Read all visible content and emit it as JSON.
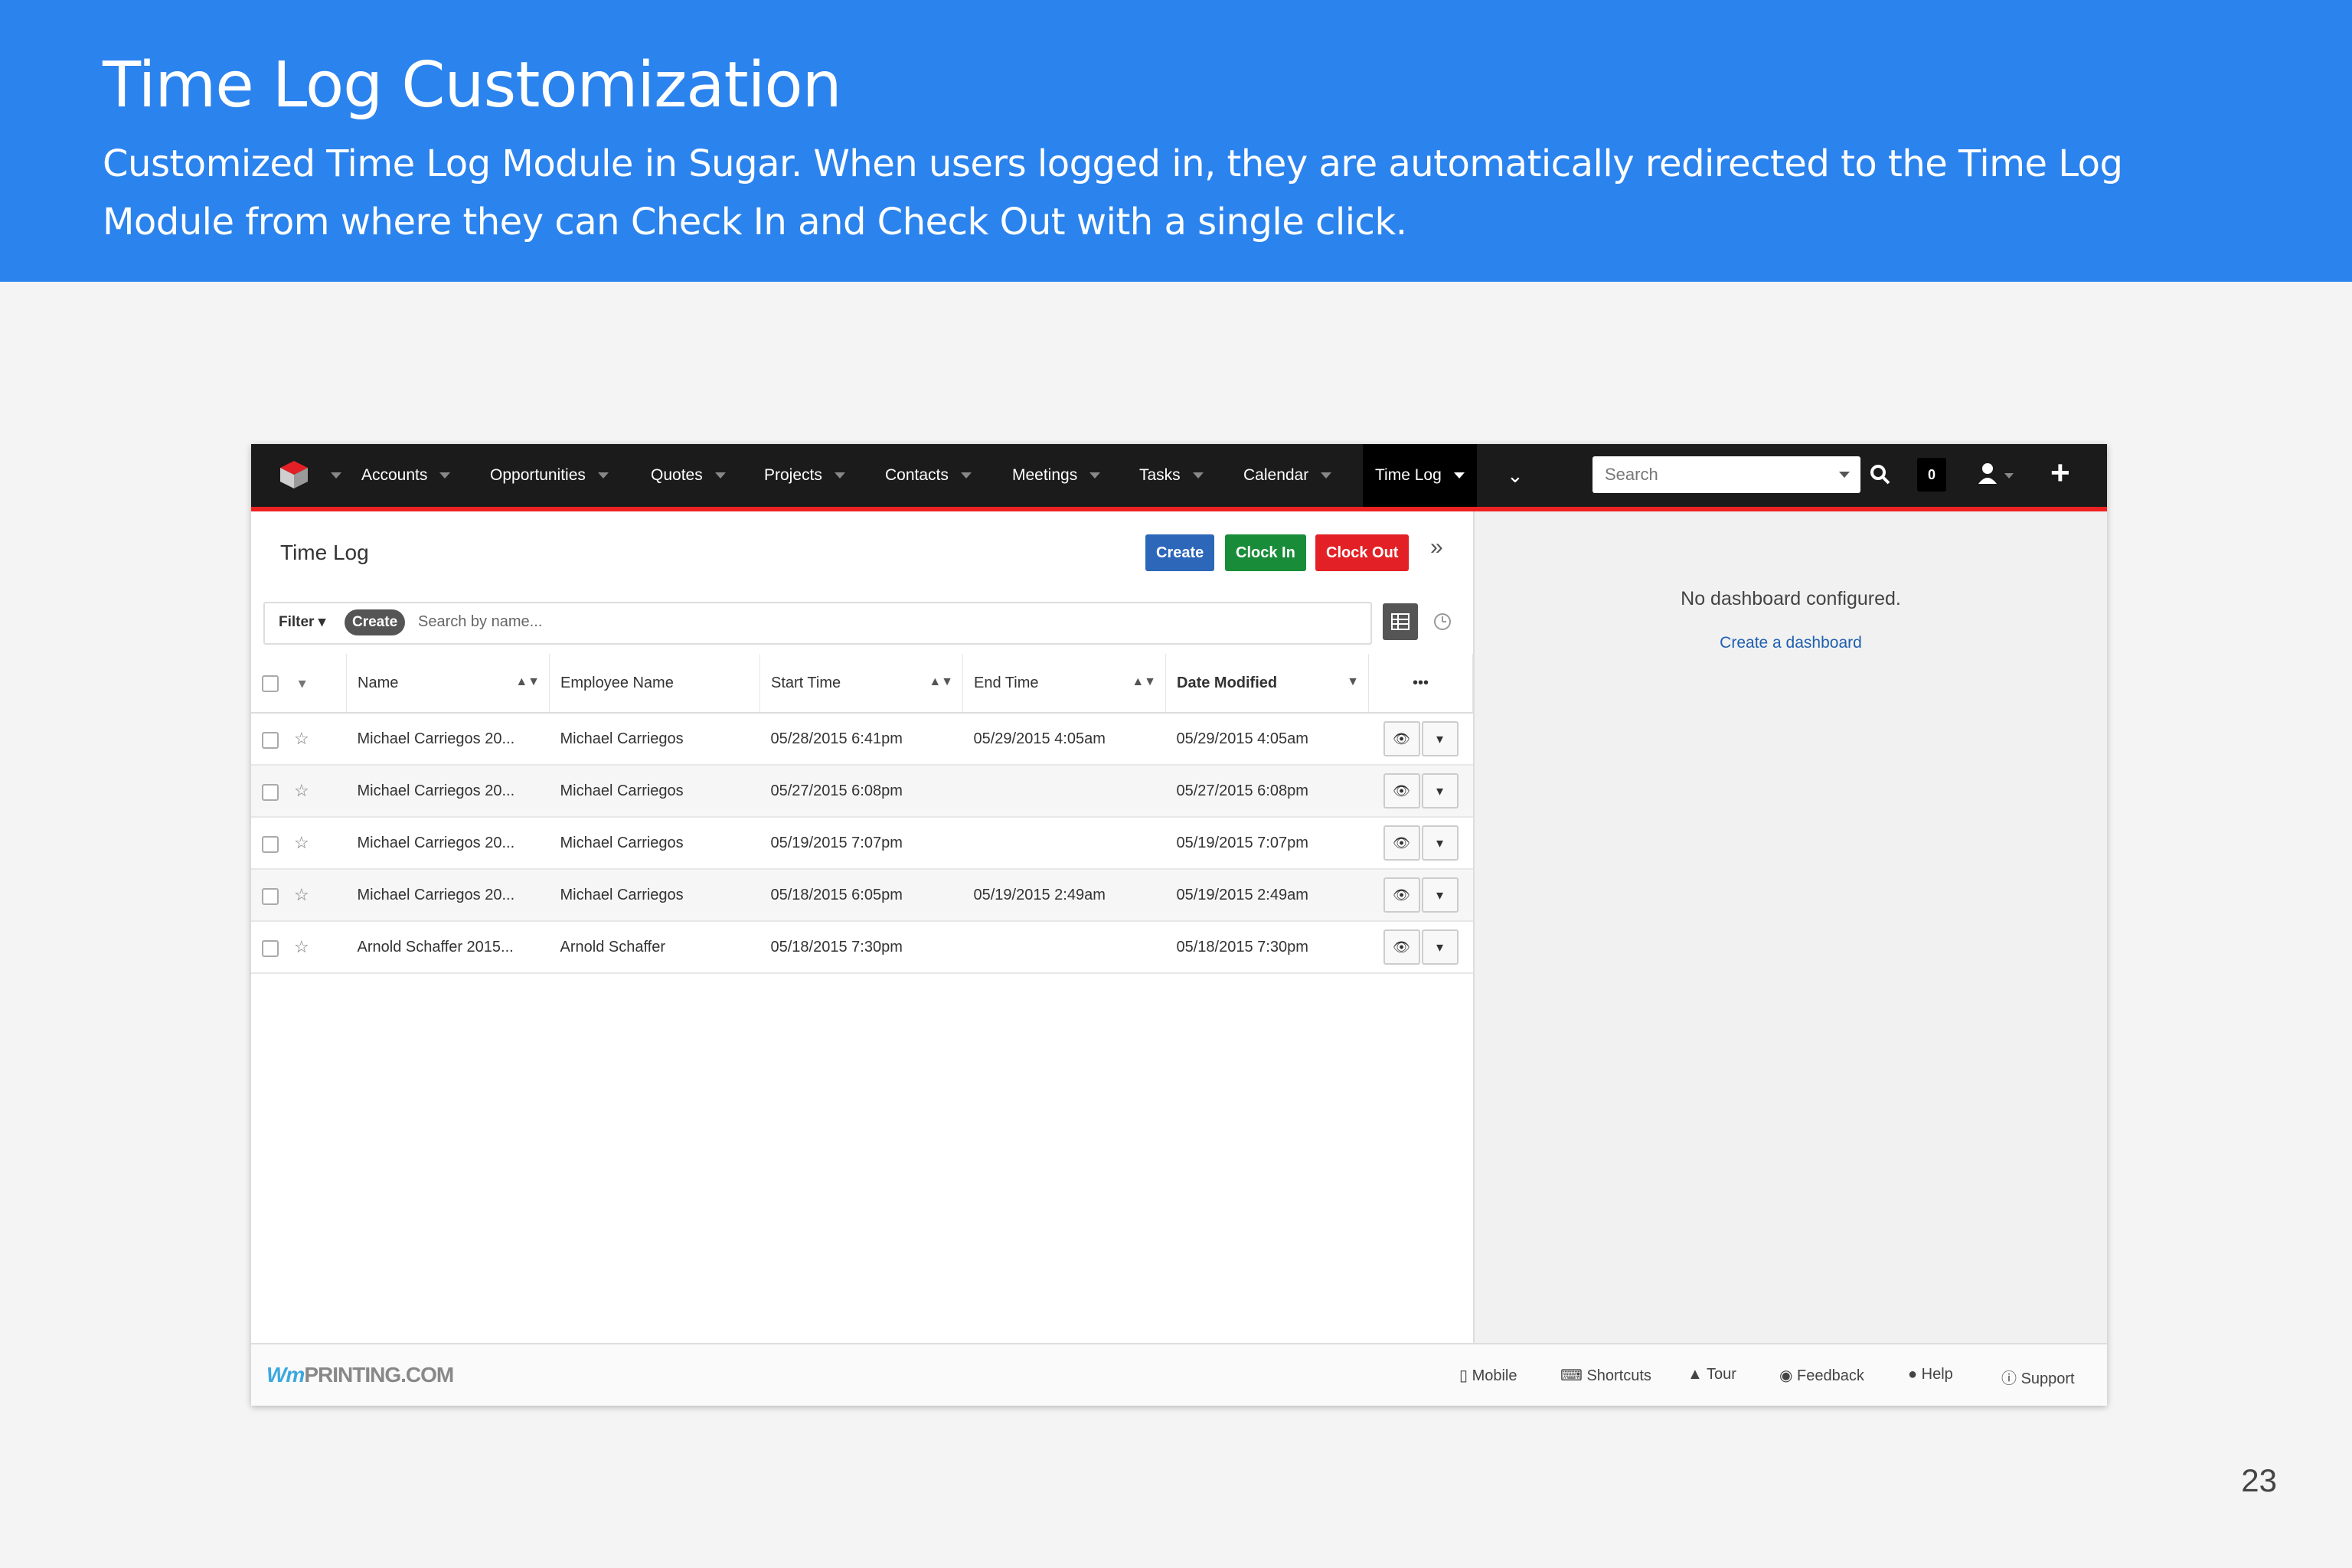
{
  "banner": {
    "title": "Time Log Customization",
    "subtitle": "Customized Time Log Module in Sugar. When users logged in, they are automatically redirected to the Time Log Module from where they can Check In and Check Out with a single click."
  },
  "page_number": "23",
  "navbar": {
    "items": [
      "Accounts",
      "Opportunities",
      "Quotes",
      "Projects",
      "Contacts",
      "Meetings",
      "Tasks",
      "Calendar",
      "Time Log"
    ],
    "active": "Time Log",
    "search_placeholder": "Search",
    "notification_count": "0"
  },
  "list": {
    "title": "Time Log",
    "buttons": {
      "create": "Create",
      "clock_in": "Clock In",
      "clock_out": "Clock Out"
    },
    "filter": {
      "label": "Filter",
      "create": "Create",
      "search_placeholder": "Search by name..."
    },
    "columns": [
      "Name",
      "Employee Name",
      "Start Time",
      "End Time",
      "Date Modified"
    ],
    "rows": [
      {
        "name": "Michael Carriegos 20...",
        "employee": "Michael Carriegos",
        "start": "05/28/2015 6:41pm",
        "end": "05/29/2015 4:05am",
        "modified": "05/29/2015 4:05am"
      },
      {
        "name": "Michael Carriegos 20...",
        "employee": "Michael Carriegos",
        "start": "05/27/2015 6:08pm",
        "end": "",
        "modified": "05/27/2015 6:08pm"
      },
      {
        "name": "Michael Carriegos 20...",
        "employee": "Michael Carriegos",
        "start": "05/19/2015 7:07pm",
        "end": "",
        "modified": "05/19/2015 7:07pm"
      },
      {
        "name": "Michael Carriegos 20...",
        "employee": "Michael Carriegos",
        "start": "05/18/2015 6:05pm",
        "end": "05/19/2015 2:49am",
        "modified": "05/19/2015 2:49am"
      },
      {
        "name": "Arnold Schaffer 2015...",
        "employee": "Arnold Schaffer",
        "start": "05/18/2015 7:30pm",
        "end": "",
        "modified": "05/18/2015 7:30pm"
      }
    ]
  },
  "dashboard": {
    "message": "No dashboard configured.",
    "link": "Create a dashboard"
  },
  "footer": {
    "brand": "PRINTING.COM",
    "links": [
      "Mobile",
      "Shortcuts",
      "Tour",
      "Feedback",
      "Help",
      "Support"
    ]
  },
  "colors": {
    "banner": "#2b83ee",
    "nav_accent": "#e22026",
    "create": "#2c67b9",
    "clock_in": "#198c3a",
    "clock_out": "#e22026"
  }
}
